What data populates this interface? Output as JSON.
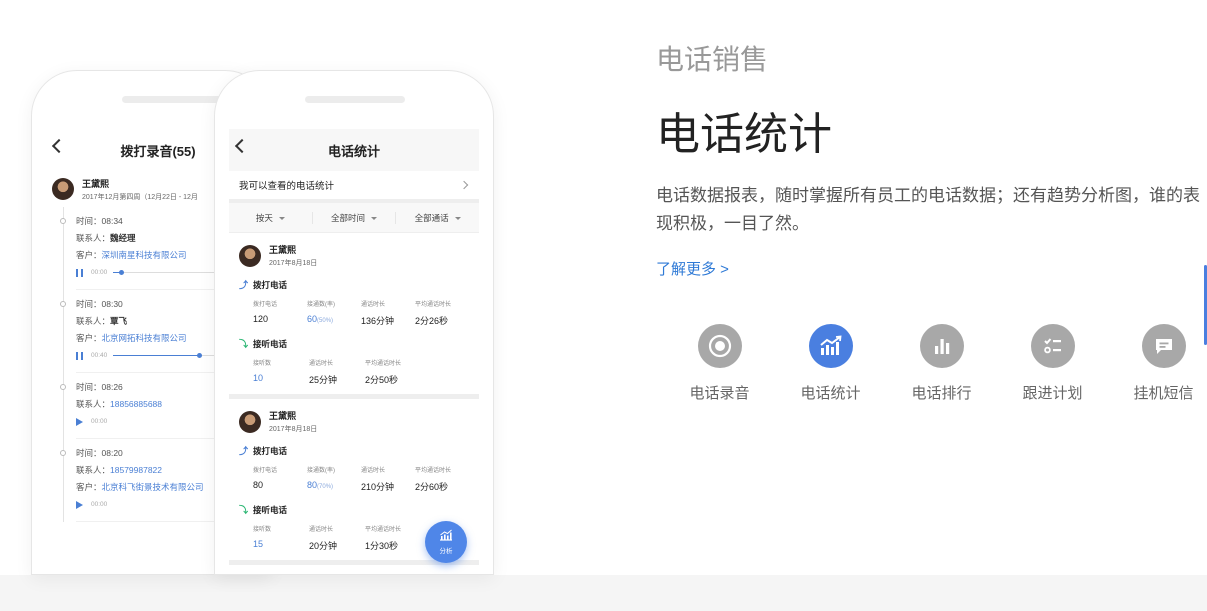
{
  "back_phone": {
    "title": "拨打录音(55)",
    "caller": {
      "name": "王黛熙",
      "subtitle": "2017年12月第四周（12月22日 - 12月"
    },
    "records": [
      {
        "time": "时间：08:34",
        "contact_label": "联系人：",
        "contact": "魏经理",
        "customer_label": "客户：",
        "customer": "深圳南星科技有限公司",
        "player_time": "00:00",
        "state": "paused",
        "progress": 0.05
      },
      {
        "time": "时间：08:30",
        "contact_label": "联系人：",
        "contact": "覃飞",
        "customer_label": "客户：",
        "customer": "北京网拓科技有限公司",
        "player_time": "00:40",
        "state": "paused",
        "progress": 0.55
      },
      {
        "time": "时间：08:26",
        "contact_label": "联系人：",
        "contact": "18856885688",
        "player_time": "00:00",
        "state": "stopped"
      },
      {
        "time": "时间：08:20",
        "contact_label": "联系人：",
        "contact": "18579987822",
        "customer_label": "客户：",
        "customer": "北京科飞街景技术有限公司",
        "player_time": "00:00",
        "state": "stopped"
      }
    ]
  },
  "front_phone": {
    "title": "电话统计",
    "viewable": "我可以查看的电话统计",
    "filters": [
      "按天",
      "全部时间",
      "全部通话"
    ],
    "blocks": [
      {
        "name": "王黛熙",
        "date": "2017年8月18日",
        "outgoing_title": "拨打电话",
        "outgoing": [
          {
            "label": "拨打电话",
            "value": "120"
          },
          {
            "label": "接通数(率)",
            "value": "60",
            "sub": "(50%)"
          },
          {
            "label": "通话时长",
            "value": "136分钟"
          },
          {
            "label": "平均通话时长",
            "value": "2分26秒"
          }
        ],
        "incoming_title": "接听电话",
        "incoming": [
          {
            "label": "接听数",
            "value": "10"
          },
          {
            "label": "通话时长",
            "value": "25分钟"
          },
          {
            "label": "平均通话时长",
            "value": "2分50秒"
          }
        ]
      },
      {
        "name": "王黛熙",
        "date": "2017年8月18日",
        "outgoing_title": "拨打电话",
        "outgoing": [
          {
            "label": "拨打电话",
            "value": "80"
          },
          {
            "label": "接通数(率)",
            "value": "80",
            "sub": "(70%)"
          },
          {
            "label": "通话时长",
            "value": "210分钟"
          },
          {
            "label": "平均通话时长",
            "value": "2分60秒"
          }
        ],
        "incoming_title": "接听电话",
        "incoming": [
          {
            "label": "接听数",
            "value": "15"
          },
          {
            "label": "通话时长",
            "value": "20分钟"
          },
          {
            "label": "平均通话时长",
            "value": "1分30秒"
          }
        ]
      }
    ],
    "fab_label": "分析"
  },
  "content": {
    "category": "电话销售",
    "title": "电话统计",
    "description": "电话数据报表，随时掌握所有员工的电话数据；还有趋势分析图，谁的表现积极，一目了然。",
    "learn_more": "了解更多 >",
    "features": [
      {
        "label": "电话录音",
        "icon": "record-icon",
        "active": false
      },
      {
        "label": "电话统计",
        "icon": "trend-chart-icon",
        "active": true
      },
      {
        "label": "电话排行",
        "icon": "bar-chart-icon",
        "active": false
      },
      {
        "label": "跟进计划",
        "icon": "checklist-icon",
        "active": false
      },
      {
        "label": "挂机短信",
        "icon": "message-icon",
        "active": false
      }
    ]
  },
  "colors": {
    "accent": "#4a7fe0",
    "inactive_icon": "#a8a8a8",
    "link": "#2f7ad6"
  }
}
